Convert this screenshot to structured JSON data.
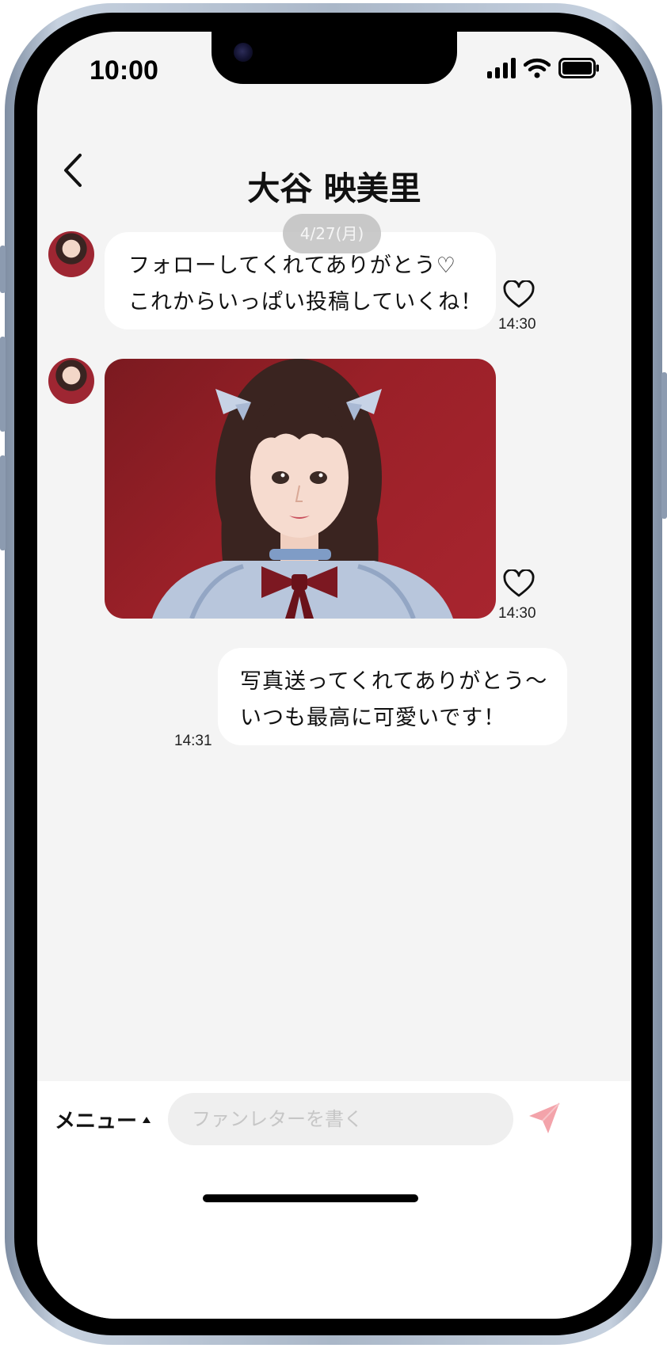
{
  "status_bar": {
    "time": "10:00",
    "icons": [
      "signal-icon",
      "wifi-icon",
      "battery-icon"
    ]
  },
  "header": {
    "title": "大谷 映美里",
    "back_icon": "chevron-left-icon"
  },
  "date_separator": "4/27(月)",
  "messages": [
    {
      "sender": "idol",
      "lines": [
        "フォローしてくれてありがとう♡",
        "これからいっぱい投稿していくね！"
      ],
      "time": "14:30",
      "liked": false
    },
    {
      "sender": "idol",
      "type": "photo",
      "time": "14:30",
      "liked": false
    },
    {
      "sender": "me",
      "lines": [
        "写真送ってくれてありがとう〜",
        "いつも最高に可愛いです！"
      ],
      "time": "14:31"
    }
  ],
  "composer": {
    "menu_label": "メニュー",
    "menu_icon": "caret-up-icon",
    "placeholder": "ファンレターを書く",
    "send_icon": "paper-plane-icon"
  },
  "colors": {
    "background": "#f4f4f4",
    "bubble": "#ffffff",
    "accent_send": "#f3a3aa",
    "photo_bg": "#9a2028"
  }
}
